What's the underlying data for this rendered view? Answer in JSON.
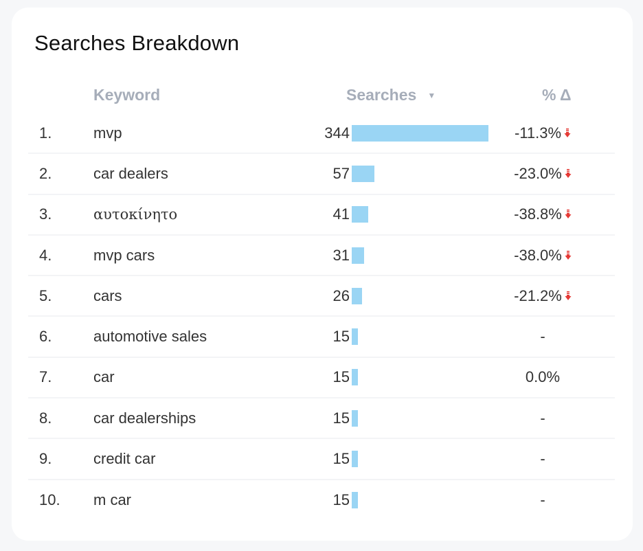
{
  "card": {
    "title": "Searches Breakdown"
  },
  "table": {
    "columns": {
      "rank": "",
      "keyword": "Keyword",
      "searches": "Searches",
      "delta": "% Δ"
    },
    "sort": {
      "column": "searches",
      "direction": "desc",
      "icon": "sort-down-icon"
    },
    "max_searches": 344,
    "bar_color": "#9ad5f4",
    "down_color": "#e53935",
    "rows": [
      {
        "rank": "1.",
        "keyword": "mvp",
        "searches": 344,
        "searches_label": "344",
        "delta": "-11.3%",
        "trend": "down"
      },
      {
        "rank": "2.",
        "keyword": "car dealers",
        "searches": 57,
        "searches_label": "57",
        "delta": "-23.0%",
        "trend": "down"
      },
      {
        "rank": "3.",
        "keyword": "αυτοκίνητο",
        "searches": 41,
        "searches_label": "41",
        "delta": "-38.8%",
        "trend": "down"
      },
      {
        "rank": "4.",
        "keyword": "mvp cars",
        "searches": 31,
        "searches_label": "31",
        "delta": "-38.0%",
        "trend": "down"
      },
      {
        "rank": "5.",
        "keyword": "cars",
        "searches": 26,
        "searches_label": "26",
        "delta": "-21.2%",
        "trend": "down"
      },
      {
        "rank": "6.",
        "keyword": "automotive sales",
        "searches": 15,
        "searches_label": "15",
        "delta": "-",
        "trend": "none"
      },
      {
        "rank": "7.",
        "keyword": "car",
        "searches": 15,
        "searches_label": "15",
        "delta": "0.0%",
        "trend": "none"
      },
      {
        "rank": "8.",
        "keyword": "car dealerships",
        "searches": 15,
        "searches_label": "15",
        "delta": "-",
        "trend": "none"
      },
      {
        "rank": "9.",
        "keyword": "credit car",
        "searches": 15,
        "searches_label": "15",
        "delta": "-",
        "trend": "none"
      },
      {
        "rank": "10.",
        "keyword": "m car",
        "searches": 15,
        "searches_label": "15",
        "delta": "-",
        "trend": "none"
      }
    ]
  }
}
